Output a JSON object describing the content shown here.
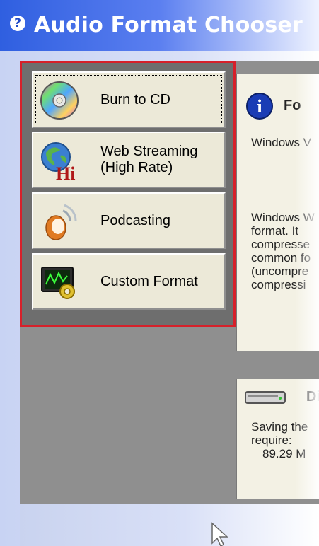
{
  "window": {
    "title": "Audio Format Chooser"
  },
  "format_buttons": [
    {
      "label": "Burn to CD",
      "icon": "cd-icon"
    },
    {
      "label": "Web Streaming\n(High Rate)",
      "icon": "globe-hi-icon"
    },
    {
      "label": "Podcasting",
      "icon": "podcast-icon"
    },
    {
      "label": "Custom Format",
      "icon": "custom-format-icon"
    }
  ],
  "info_panel": {
    "heading": "Fo",
    "line1": "Windows V",
    "desc_lines": [
      "Windows W",
      "format.  It",
      "compresse",
      "common fo",
      "(uncompre",
      "compressi"
    ]
  },
  "disk_panel": {
    "heading": "Di",
    "lines": [
      "Saving the",
      "require:"
    ],
    "size": "89.29 M"
  },
  "colors": {
    "selection_border": "#d6202a",
    "title_gradient_start": "#2f5fe0"
  }
}
